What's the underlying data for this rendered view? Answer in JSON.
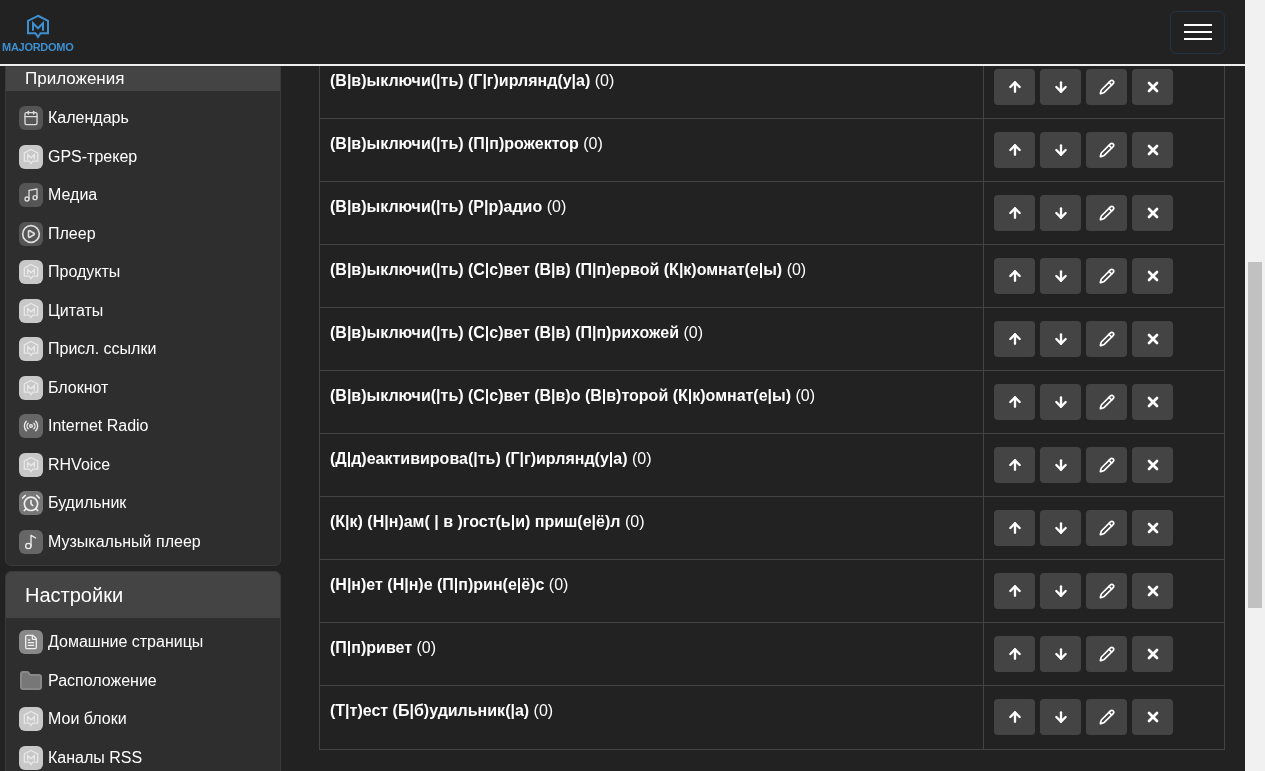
{
  "navbar": {
    "logo_text": "MAJORDOMO"
  },
  "sidebar": [
    {
      "title": "Приложения",
      "items": [
        "Календарь",
        "GPS-трекер",
        "Медиа",
        "Плеер",
        "Продукты",
        "Цитаты",
        "Присл. ссылки",
        "Блокнот",
        "Internet Radio",
        "RHVoice",
        "Будильник",
        "Музыкальный плеер"
      ]
    },
    {
      "title": "Настройки",
      "items": [
        "Домашние страницы",
        "Расположение",
        "Мои блоки",
        "Каналы RSS"
      ]
    }
  ],
  "table": {
    "rows": [
      "**(В|в)ыключи(|ть) (Г|г)ирлянд(у|а)** (0)",
      "**(В|в)ыключи(|ть) (П|п)рожектор** (0)",
      "**(В|в)ыключи(|ть) (Р|р)адио** (0)",
      "**(В|в)ыключи(|ть) (С|с)вет (В|в) (П|п)ервой (К|к)омнат(е|ы)** (0)",
      "**(В|в)ыключи(|ть) (С|с)вет (В|в) (П|п)рихожей** (0)",
      "**(В|в)ыключи(|ть) (С|с)вет (В|в)о (В|в)торой (К|к)омнат(е|ы)** (0)",
      "**(Д|д)еактивирова(|ть) (Г|г)ирлянд(у|а)** (0)",
      "**(К|к) (Н|н)ам( | в )гост(ь|и) приш(е|ё)л** (0)",
      "**(Н|н)ет (Н|н)е (П|п)рин(е|ё)с** (0)",
      "**(П|п)ривет** (0)",
      "**(Т|т)ест (Б|б)удильник(|а)** (0)"
    ]
  }
}
